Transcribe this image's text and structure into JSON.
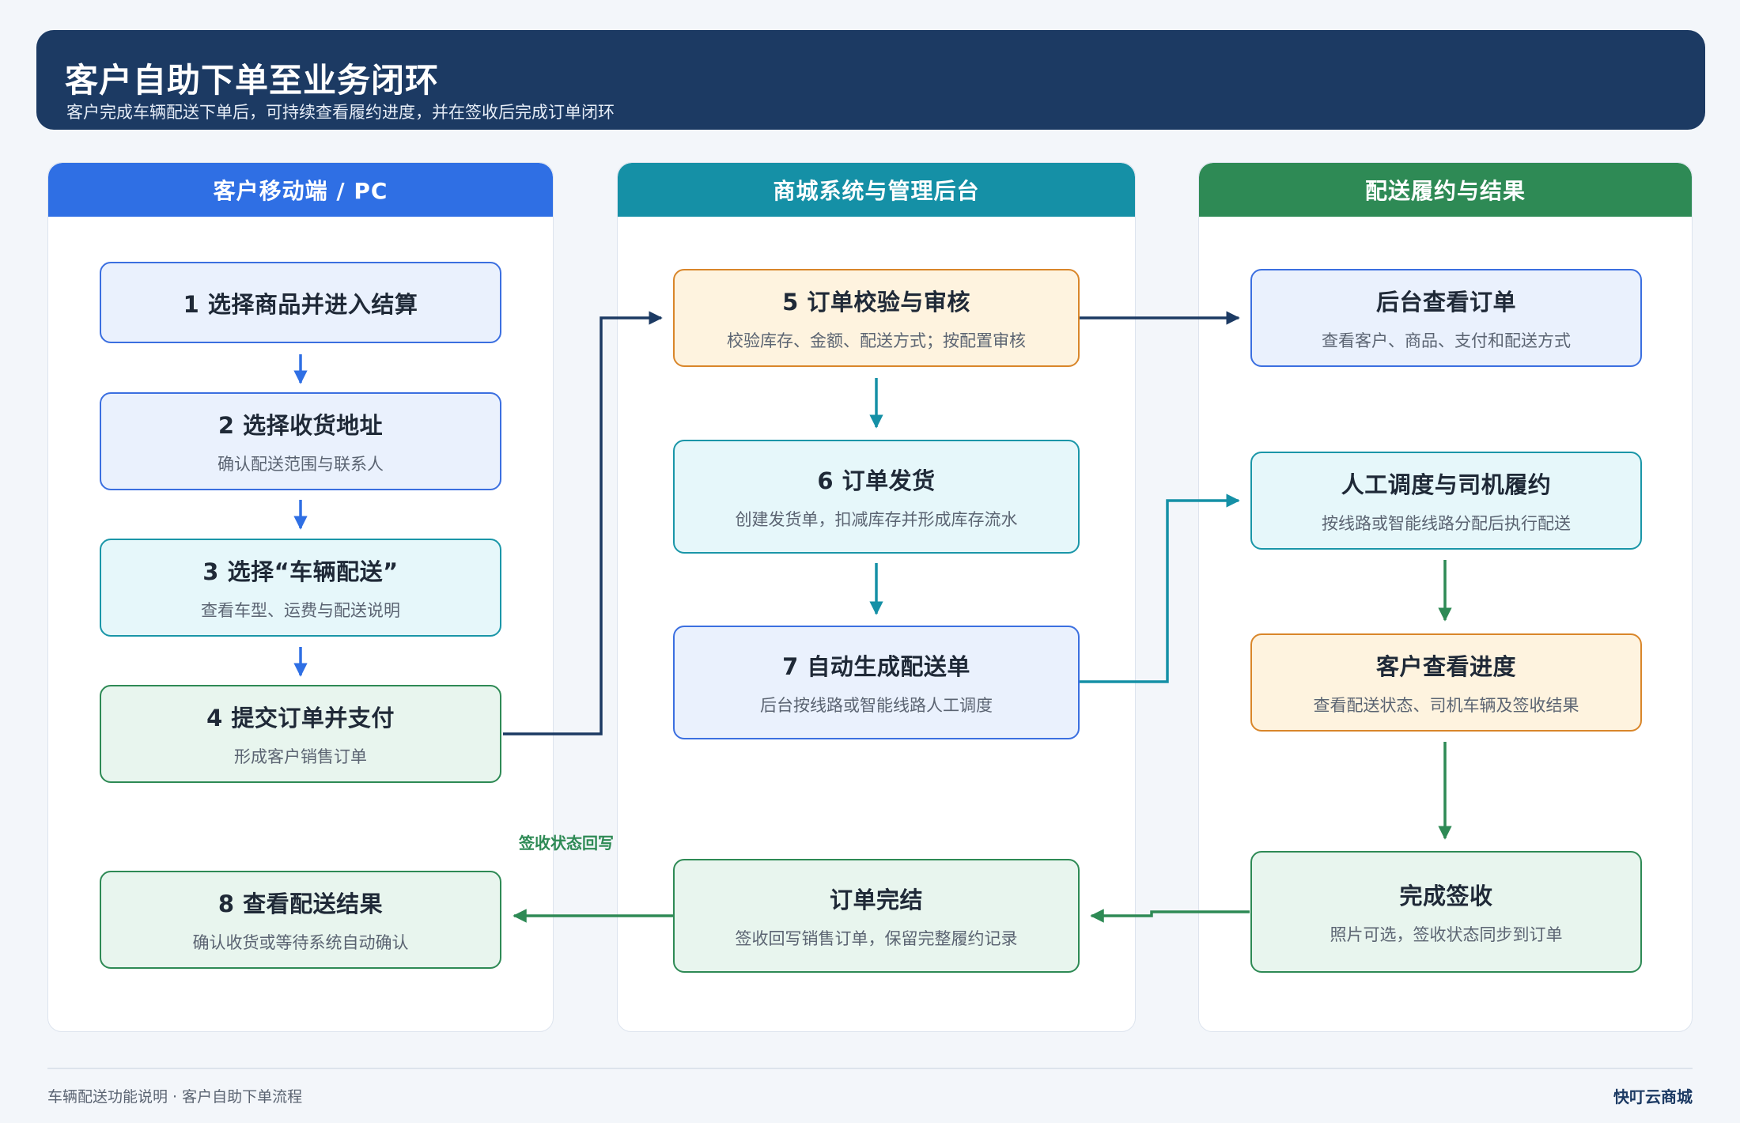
{
  "header": {
    "title": "客户自助下单至业务闭环",
    "subtitle": "客户完成车辆配送下单后，可持续查看履约进度，并在签收后完成订单闭环"
  },
  "lanes": [
    {
      "title": "客户移动端 / PC",
      "color": "#2f6fe4"
    },
    {
      "title": "商城系统与管理后台",
      "color": "#1590a6"
    },
    {
      "title": "配送履约与结果",
      "color": "#2e8a55"
    }
  ],
  "nodes": {
    "n1": {
      "title": "1  选择商品并进入结算",
      "sub": ""
    },
    "n2": {
      "title": "2  选择收货地址",
      "sub": "确认配送范围与联系人"
    },
    "n3": {
      "title": "3  选择“车辆配送”",
      "sub": "查看车型、运费与配送说明"
    },
    "n4": {
      "title": "4  提交订单并支付",
      "sub": "形成客户销售订单"
    },
    "n8": {
      "title": "8  查看配送结果",
      "sub": "确认收货或等待系统自动确认"
    },
    "n5": {
      "title": "5  订单校验与审核",
      "sub": "校验库存、金额、配送方式；按配置审核"
    },
    "n6": {
      "title": "6  订单发货",
      "sub": "创建发货单，扣减库存并形成库存流水"
    },
    "n7": {
      "title": "7  自动生成配送单",
      "sub": "后台按线路或智能线路人工调度"
    },
    "ndone": {
      "title": "订单完结",
      "sub": "签收回写销售订单，保留完整履约记录"
    },
    "r1": {
      "title": "后台查看订单",
      "sub": "查看客户、商品、支付和配送方式"
    },
    "r2": {
      "title": "人工调度与司机履约",
      "sub": "按线路或智能线路分配后执行配送"
    },
    "r3": {
      "title": "客户查看进度",
      "sub": "查看配送状态、司机车辆及签收结果"
    },
    "r4": {
      "title": "完成签收",
      "sub": "照片可选，签收状态同步到订单"
    }
  },
  "note": "签收状态回写",
  "footer": {
    "left": "车辆配送功能说明 · 客户自助下单流程",
    "right": "快叮云商城"
  },
  "colors": {
    "navy": "#1c3a63",
    "blue": "#2f6fe4",
    "teal": "#1590a6",
    "green": "#2e8a55",
    "orange": "#d9862a"
  }
}
